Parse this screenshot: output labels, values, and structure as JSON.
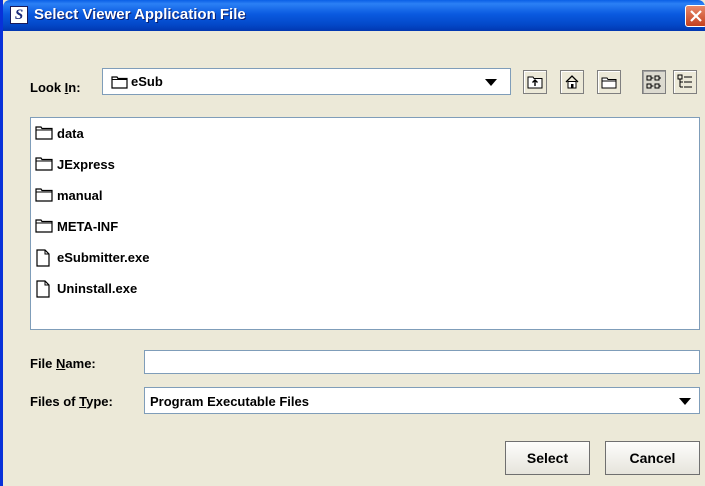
{
  "window": {
    "title": "Select Viewer Application File",
    "app_icon_letter": "S"
  },
  "look_in": {
    "label_pre": "Look ",
    "label_mnemonic": "I",
    "label_post": "n:",
    "value": "eSub"
  },
  "toolbar": {
    "up_one_level": "up-folder-icon",
    "home": "home-icon",
    "new_folder": "new-folder-icon",
    "list_view": "list-view-icon",
    "details_view": "details-view-icon"
  },
  "files": [
    {
      "name": "data",
      "type": "folder"
    },
    {
      "name": "JExpress",
      "type": "folder"
    },
    {
      "name": "manual",
      "type": "folder"
    },
    {
      "name": "META-INF",
      "type": "folder"
    },
    {
      "name": "eSubmitter.exe",
      "type": "file"
    },
    {
      "name": "Uninstall.exe",
      "type": "file"
    }
  ],
  "file_name": {
    "label_pre": "File ",
    "label_mnemonic": "N",
    "label_post": "ame:",
    "value": ""
  },
  "file_type": {
    "label_pre": "Files of ",
    "label_mnemonic": "T",
    "label_post": "ype:",
    "value": "Program Executable Files"
  },
  "buttons": {
    "select": "Select",
    "cancel": "Cancel"
  }
}
